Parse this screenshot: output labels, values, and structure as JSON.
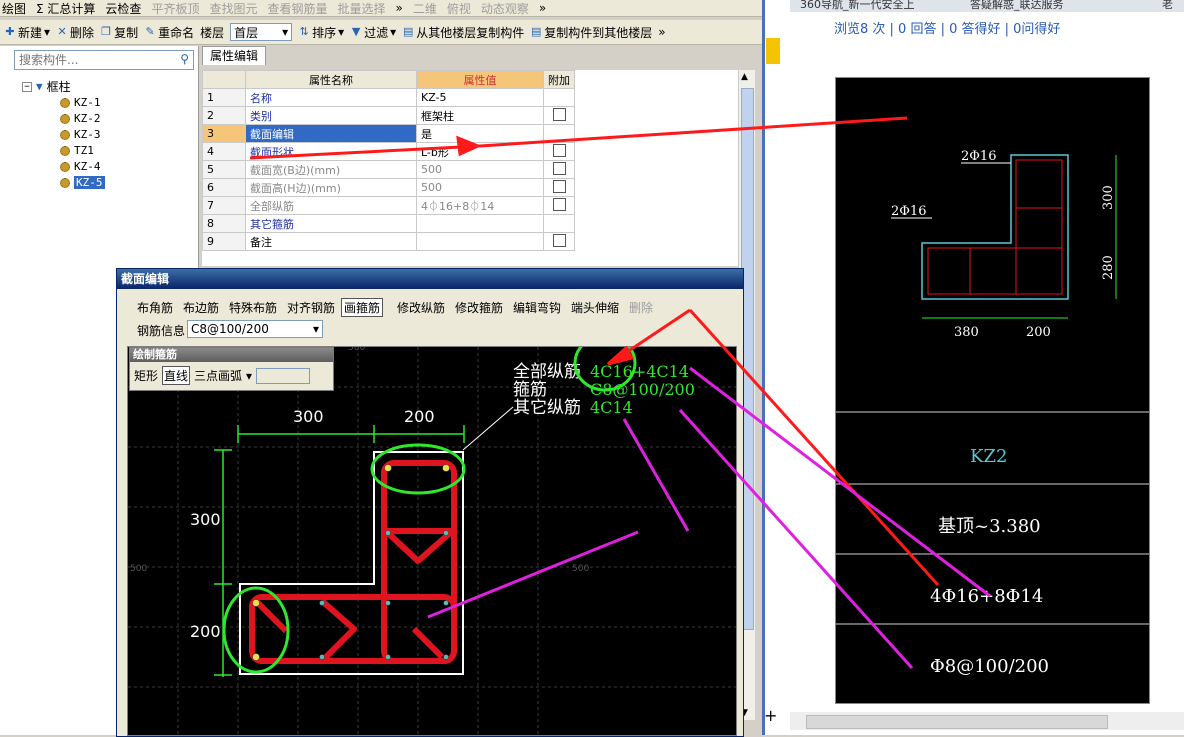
{
  "menubar": {
    "items": [
      "绘图",
      "Σ 汇总计算",
      "云检查",
      "平齐板顶",
      "查找图元",
      "查看钢筋量",
      "批量选择",
      "»",
      "二维",
      "俯视",
      "动态观察",
      "»"
    ]
  },
  "toolbar": {
    "new": "新建",
    "delete": "删除",
    "copy": "复制",
    "rename": "重命名",
    "floor_label": "楼层",
    "floor_value": "首层",
    "sort": "排序",
    "filter": "过滤",
    "copy_from_floor": "从其他楼层复制构件",
    "copy_to_floor": "复制构件到其他楼层",
    "more": "»"
  },
  "tree": {
    "search_placeholder": "搜索构件...",
    "root": "框柱",
    "items": [
      "KZ-1",
      "KZ-2",
      "KZ-3",
      "TZ1",
      "KZ-4",
      "KZ-5"
    ]
  },
  "props": {
    "tab": "属性编辑",
    "col_name": "属性名称",
    "col_value": "属性值",
    "col_extra": "附加",
    "rows": [
      {
        "n": "1",
        "name": "名称",
        "value": "KZ-5"
      },
      {
        "n": "2",
        "name": "类别",
        "value": "框架柱"
      },
      {
        "n": "3",
        "name": "截面编辑",
        "value": "是"
      },
      {
        "n": "4",
        "name": "截面形状",
        "value": "L-b形"
      },
      {
        "n": "5",
        "name": "截面宽(B边)(mm)",
        "value": "500"
      },
      {
        "n": "6",
        "name": "截面高(H边)(mm)",
        "value": "500"
      },
      {
        "n": "7",
        "name": "全部纵筋",
        "value": "4⏀16+8⏀14"
      },
      {
        "n": "8",
        "name": "其它箍筋",
        "value": ""
      },
      {
        "n": "9",
        "name": "备注",
        "value": ""
      }
    ]
  },
  "dialog": {
    "title": "截面编辑",
    "tools": [
      "布角筋",
      "布边筋",
      "特殊布筋",
      "对齐钢筋",
      "画箍筋",
      "修改纵筋",
      "修改箍筋",
      "编辑弯钩",
      "端头伸缩",
      "删除"
    ],
    "info_label": "钢筋信息",
    "info_value": "C8@100/200",
    "draw_title": "绘制箍筋",
    "draw_rect": "矩形",
    "draw_line": "直线",
    "draw_arc": "三点画弧",
    "dim_w1": "300",
    "dim_w2": "200",
    "dim_h1": "300",
    "dim_h2": "200",
    "grid_l": "500",
    "grid_r": "500",
    "grid_t": "500",
    "anno_all_label": "全部纵筋",
    "anno_all_value": "4C16+4C14",
    "anno_stirrup_label": "箍筋",
    "anno_stirrup_value": "C8@100/200",
    "anno_other_label": "其它纵筋",
    "anno_other_value": "4C14"
  },
  "browser": {
    "tabs": [
      "360导航_新一代安全上",
      "答疑解惑_联达服务",
      "老"
    ],
    "stats": "浏览8 次 | 0 回答 | 0 答得好 | 0问得好"
  },
  "cad_ref": {
    "label_2phi16_a": "2Φ16",
    "label_2phi16_b": "2Φ16",
    "dim_300_v": "300",
    "dim_280_v": "280",
    "dim_380_h": "380",
    "dim_200_h": "200",
    "name": "KZ2",
    "elev": "基顶~3.380",
    "rebar": "4Φ16+8Φ14",
    "stirrup": "Φ8@100/200"
  }
}
